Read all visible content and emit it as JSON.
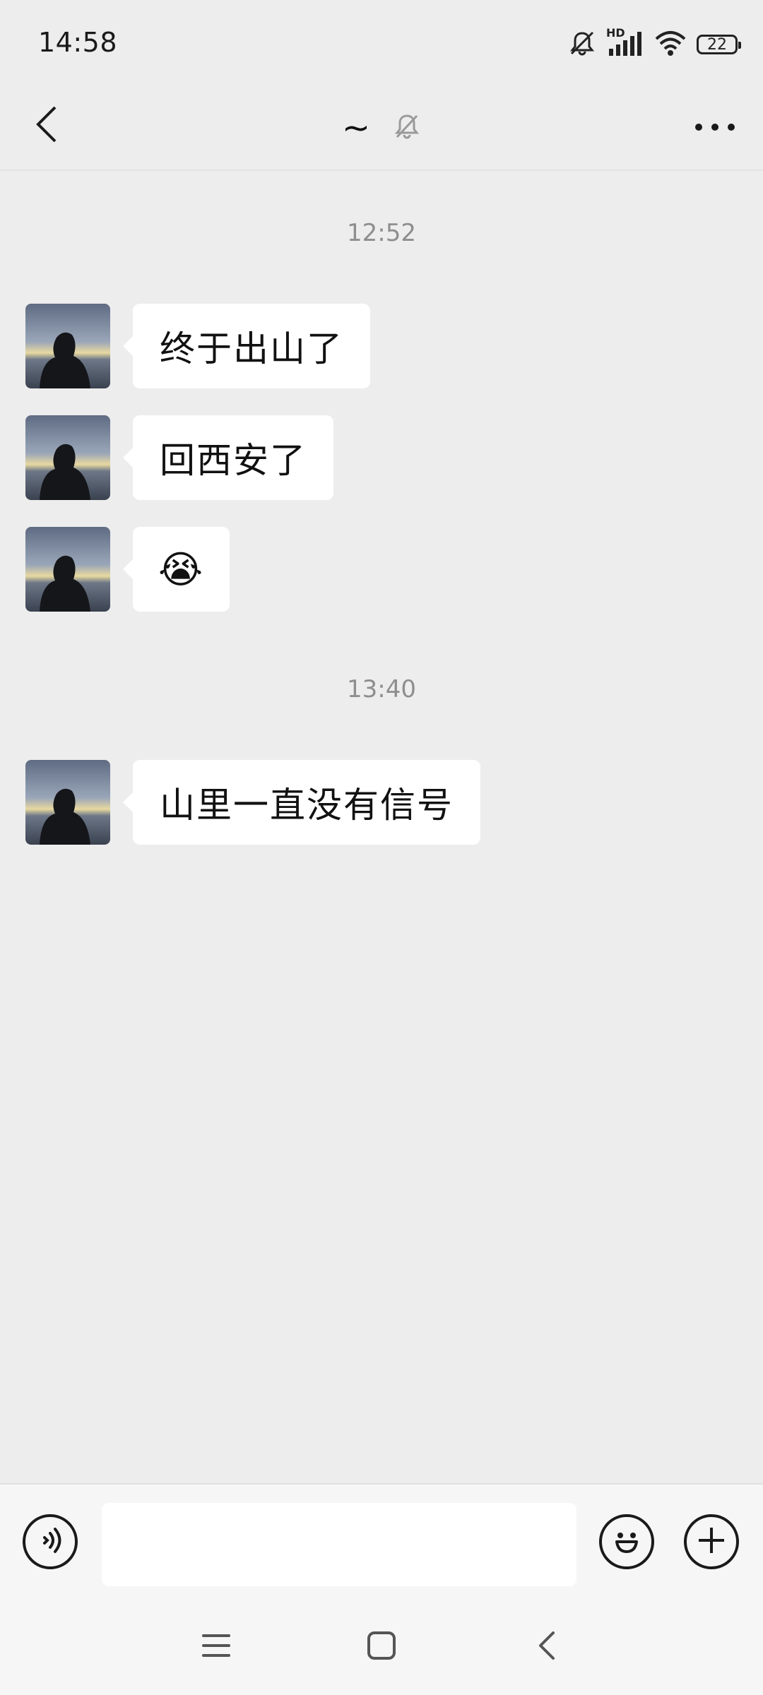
{
  "status_bar": {
    "time": "14:58",
    "network_label": "HD",
    "battery_level": "22",
    "icons": [
      "mute-bell-icon",
      "signal-icon",
      "wifi-icon",
      "battery-icon"
    ]
  },
  "nav": {
    "title": "~",
    "icons": [
      "back-chevron-icon",
      "muted-bell-icon",
      "more-dots-icon"
    ]
  },
  "chat": {
    "time_separators": [
      "12:52",
      "13:40"
    ],
    "messages": [
      {
        "text": "终于出山了"
      },
      {
        "text": "回西安了"
      },
      {
        "emoji": "😭"
      },
      {
        "text": "山里一直没有信号"
      }
    ]
  },
  "input_bar": {
    "value": "",
    "icons": [
      "voice-icon",
      "emoji-smile-icon",
      "plus-icon"
    ]
  },
  "system_nav": {
    "icons": [
      "menu-icon",
      "home-icon",
      "back-icon"
    ]
  },
  "colors": {
    "background": "#ededed",
    "bubble": "#ffffff",
    "time_text": "#8e8e8e"
  }
}
